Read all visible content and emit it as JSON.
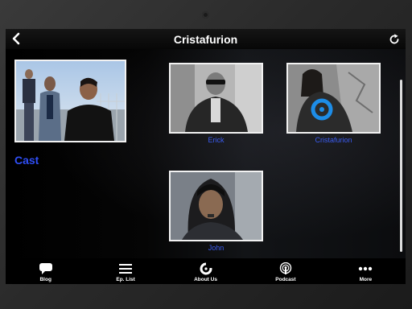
{
  "header": {
    "title": "Cristafurion",
    "back_icon": "chevron-left-icon",
    "refresh_icon": "refresh-icon"
  },
  "hero": {
    "section_label": "Cast",
    "image": "band-group-photo"
  },
  "cast": [
    {
      "name": "Erick",
      "image": "erick-portrait"
    },
    {
      "name": "Cristafurion",
      "image": "cristafurion-portrait"
    },
    {
      "name": "John",
      "image": "john-portrait"
    }
  ],
  "tabs": [
    {
      "label": "Blog",
      "icon": "speech-bubble-icon"
    },
    {
      "label": "Ep. List",
      "icon": "list-icon"
    },
    {
      "label": "About Us",
      "icon": "about-logo-icon"
    },
    {
      "label": "Podcast",
      "icon": "podcast-icon"
    },
    {
      "label": "More",
      "icon": "more-dots-icon"
    }
  ],
  "colors": {
    "accent": "#2f4ef5",
    "background": "#000000",
    "header_text": "#ffffff"
  }
}
